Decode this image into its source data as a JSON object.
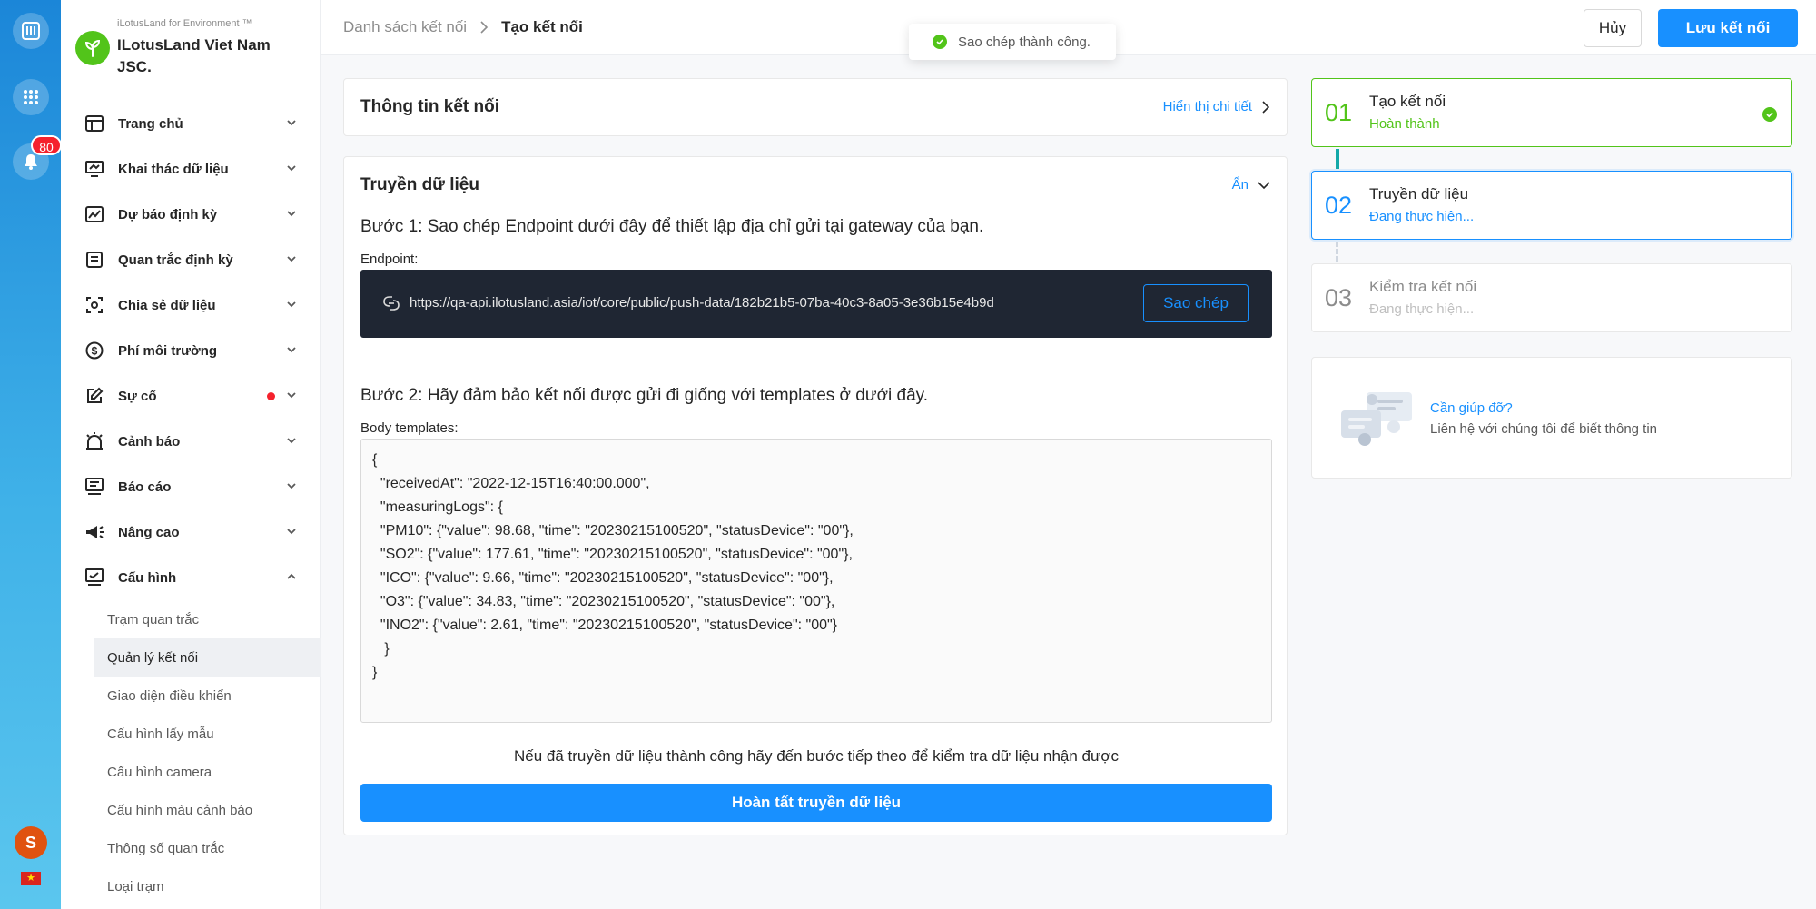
{
  "rail": {
    "notification_count": "80",
    "avatar_letter": "S"
  },
  "org": {
    "tagline": "iLotusLand for Environment ™",
    "name": "ILotusLand Viet Nam JSC."
  },
  "sidebar": {
    "items": [
      {
        "label": "Trang chủ",
        "icon": "home-icon"
      },
      {
        "label": "Khai thác dữ liệu",
        "icon": "monitor-data-icon"
      },
      {
        "label": "Dự báo định kỳ",
        "icon": "chart-line-icon"
      },
      {
        "label": "Quan trắc định kỳ",
        "icon": "list-icon"
      },
      {
        "label": "Chia sẻ dữ liệu",
        "icon": "share-scan-icon"
      },
      {
        "label": "Phí môi trường",
        "icon": "dollar-icon"
      },
      {
        "label": "Sự cố",
        "icon": "edit-icon"
      },
      {
        "label": "Cảnh báo",
        "icon": "alarm-icon"
      },
      {
        "label": "Báo cáo",
        "icon": "report-icon"
      },
      {
        "label": "Nâng cao",
        "icon": "megaphone-icon"
      },
      {
        "label": "Cấu hình",
        "icon": "settings-monitor-icon"
      }
    ],
    "config_subitems": [
      "Trạm quan trắc",
      "Quản lý kết nối",
      "Giao diện điều khiển",
      "Cấu hình lấy mẫu",
      "Cấu hình camera",
      "Cấu hình màu cảnh báo",
      "Thông số quan trắc",
      "Loại trạm"
    ],
    "active_subitem": "Quản lý kết nối"
  },
  "header": {
    "breadcrumb_prev": "Danh sách kết nối",
    "breadcrumb_current": "Tạo kết nối",
    "cancel_label": "Hủy",
    "save_label": "Lưu kết nối"
  },
  "toast": {
    "message": "Sao chép thành công."
  },
  "info_card": {
    "title": "Thông tin kết nối",
    "detail_link": "Hiển thị chi tiết"
  },
  "transfer_card": {
    "title": "Truyền dữ liệu",
    "hide_link": "Ẩn",
    "step1": "Bước 1: Sao chép Endpoint dưới đây để thiết lập địa chỉ gửi tại gateway của bạn.",
    "endpoint_label": "Endpoint:",
    "endpoint_url": "https://qa-api.ilotusland.asia/iot/core/public/push-data/182b21b5-07ba-40c3-8a05-3e36b15e4b9d",
    "copy_label": "Sao chép",
    "step2": "Bước 2: Hãy đảm bảo kết nối được gửi đi giống với templates ở dưới đây.",
    "body_label": "Body templates:",
    "code_lines": [
      "{",
      "  \"receivedAt\": \"2022-12-15T16:40:00.000\",",
      "  \"measuringLogs\": {",
      "  \"PM10\": {\"value\": 98.68, \"time\": \"20230215100520\", \"statusDevice\": \"00\"},",
      "  \"SO2\": {\"value\": 177.61, \"time\": \"20230215100520\", \"statusDevice\": \"00\"},",
      "  \"ICO\": {\"value\": 9.66, \"time\": \"20230215100520\", \"statusDevice\": \"00\"},",
      "  \"O3\": {\"value\": 34.83, \"time\": \"20230215100520\", \"statusDevice\": \"00\"},",
      "  \"INO2\": {\"value\": 2.61, \"time\": \"20230215100520\", \"statusDevice\": \"00\"}",
      "   }",
      "}"
    ],
    "hint": "Nếu đã truyền dữ liệu thành công hãy đến bước tiếp theo để kiểm tra dữ liệu nhận được",
    "complete_label": "Hoàn tất truyền dữ liệu"
  },
  "steps": [
    {
      "num": "01",
      "title": "Tạo kết nối",
      "status": "Hoàn thành",
      "state": "done"
    },
    {
      "num": "02",
      "title": "Truyền dữ liệu",
      "status": "Đang thực hiện...",
      "state": "active"
    },
    {
      "num": "03",
      "title": "Kiểm tra kết nối",
      "status": "Đang thực hiện...",
      "state": "pending"
    }
  ],
  "help": {
    "title": "Cần giúp đỡ?",
    "description": "Liên hệ với chúng tôi để biết thông tin"
  },
  "colors": {
    "primary": "#1890ff",
    "success": "#52c41a",
    "danger": "#f5222d",
    "code_bg": "#1f2633"
  }
}
